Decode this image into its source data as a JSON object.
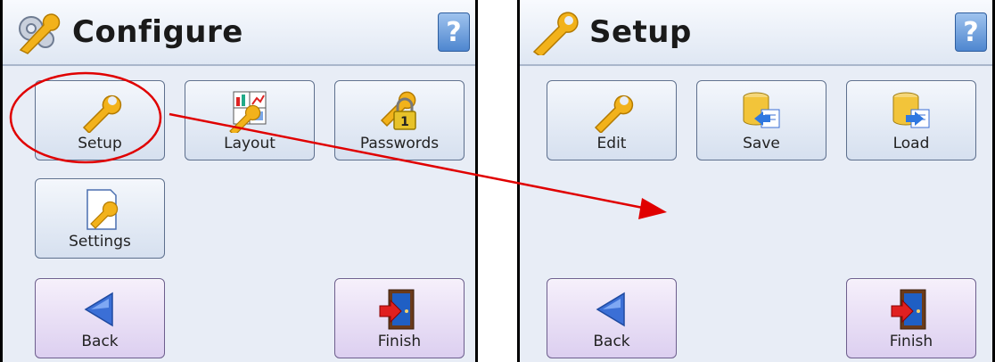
{
  "left": {
    "title": "Configure",
    "help": "?",
    "tiles": {
      "setup": "Setup",
      "layout": "Layout",
      "passwords": "Passwords",
      "settings": "Settings"
    },
    "nav": {
      "back": "Back",
      "finish": "Finish"
    }
  },
  "right": {
    "title": "Setup",
    "help": "?",
    "tiles": {
      "edit": "Edit",
      "save": "Save",
      "load": "Load"
    },
    "nav": {
      "back": "Back",
      "finish": "Finish"
    }
  },
  "colors": {
    "annotation": "#e00000",
    "wrench": "#f2b21b",
    "back_arrow": "#3b6fd6"
  },
  "icons": [
    "gears-wrench-icon",
    "wrench-icon",
    "layout-chart-icon",
    "padlock-wrench-icon",
    "settings-page-icon",
    "database-save-icon",
    "database-load-icon",
    "back-arrow-icon",
    "exit-door-icon",
    "help-icon"
  ]
}
